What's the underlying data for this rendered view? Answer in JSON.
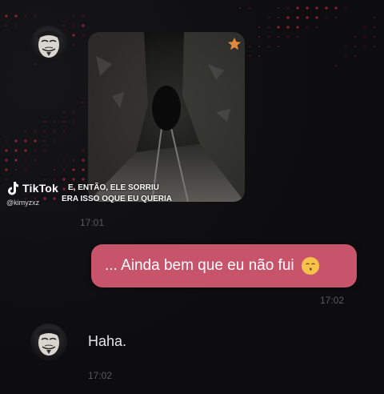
{
  "overlay": {
    "caption_line1": "E, ENTÃO, ELE SORRIU",
    "caption_line2": "ERA ISSO OQUE EU QUERIA",
    "tiktok_brand": "TikTok",
    "tiktok_handle": "@kimyzxz"
  },
  "chat": {
    "messages": [
      {
        "type": "image",
        "from": "other",
        "time": "17:01",
        "icon": "star-icon"
      },
      {
        "type": "text",
        "from": "me",
        "text": "... Ainda bem que eu não fui",
        "emoji": "kissing-face-icon",
        "time": "17:02"
      },
      {
        "type": "text",
        "from": "other",
        "text": "Haha.",
        "time": "17:02"
      }
    ]
  },
  "colors": {
    "background": "#0d0d0f",
    "my_bubble": "#c8546b",
    "timestamp": "#5a5a5e",
    "dot_accent": "#b3263c"
  }
}
